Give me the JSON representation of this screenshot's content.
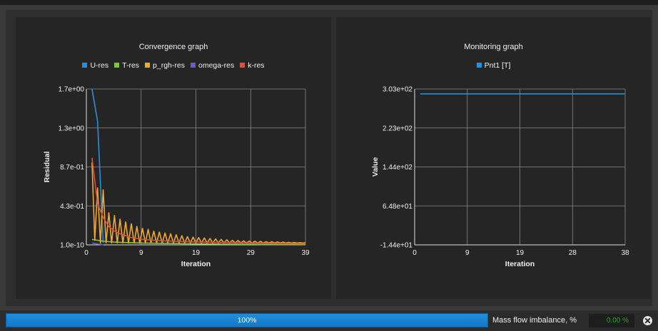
{
  "convergence": {
    "title": "Convergence graph",
    "legend": [
      {
        "name": "U-res",
        "color": "#2a8fd4"
      },
      {
        "name": "T-res",
        "color": "#7cc443"
      },
      {
        "name": "p_rgh-res",
        "color": "#f0a830"
      },
      {
        "name": "omega-res",
        "color": "#6a5acd"
      },
      {
        "name": "k-res",
        "color": "#d9533a"
      }
    ]
  },
  "monitoring": {
    "title": "Monitoring graph",
    "legend": [
      {
        "name": "Pnt1 [T]",
        "color": "#2a8fd4"
      }
    ]
  },
  "status": {
    "progress_value": 1.0,
    "progress_text": "100%",
    "mass_label": "Mass flow imbalance, %",
    "mass_value": "0.00 %",
    "close_icon": "close-icon",
    "colors": {
      "progress": "#1f8fdc",
      "mass_value": "#2ca02c"
    }
  },
  "chart_data": [
    {
      "type": "line",
      "title": "Convergence graph",
      "xlabel": "Iteration",
      "ylabel": "Residual",
      "xlim": [
        0,
        39
      ],
      "ylim": [
        1e-10,
        1.7
      ],
      "x_ticks": [
        "0",
        "9",
        "19",
        "29",
        "39"
      ],
      "y_ticks": [
        "1.0e-10",
        "4.3e-01",
        "8.7e-01",
        "1.3e+00",
        "1.7e+00"
      ],
      "grid": true,
      "legend_position": "top-center",
      "series": [
        {
          "name": "U-res",
          "color": "#2a8fd4",
          "x": [
            1,
            2,
            3
          ],
          "values": [
            1.7,
            1.35,
            0.02
          ]
        },
        {
          "name": "T-res",
          "color": "#7cc443",
          "x": [
            1,
            2,
            3,
            4,
            5,
            6,
            7,
            8,
            9,
            10,
            11,
            12,
            13,
            14,
            15,
            16,
            17,
            18,
            19,
            20,
            21,
            22,
            23,
            24,
            25,
            26,
            27,
            28,
            29,
            30,
            31,
            32,
            33,
            34,
            35,
            36,
            37,
            38,
            39
          ],
          "values": [
            0.06,
            0.05,
            0.04,
            0.035,
            0.03,
            0.028,
            0.026,
            0.024,
            0.022,
            0.02,
            0.019,
            0.018,
            0.017,
            0.016,
            0.015,
            0.014,
            0.013,
            0.012,
            0.011,
            0.01,
            0.01,
            0.009,
            0.009,
            0.008,
            0.008,
            0.007,
            0.007,
            0.006,
            0.006,
            0.006,
            0.005,
            0.005,
            0.005,
            0.005,
            0.004,
            0.004,
            0.004,
            0.004,
            0.004
          ]
        },
        {
          "name": "p_rgh-res",
          "color": "#f0a830",
          "x": [
            1,
            1.5,
            2,
            2.5,
            3,
            3.5,
            4,
            4.5,
            5,
            5.5,
            6,
            6.5,
            7,
            7.5,
            8,
            8.5,
            9,
            9.5,
            10,
            10.5,
            11,
            11.5,
            12,
            12.5,
            13,
            13.5,
            14,
            14.5,
            15,
            15.5,
            16,
            16.5,
            17,
            17.5,
            18,
            18.5,
            19,
            19.5,
            20,
            20.5,
            21,
            21.5,
            22,
            22.5,
            23,
            23.5,
            24,
            24.5,
            25,
            25.5,
            26,
            26.5,
            27,
            27.5,
            28,
            28.5,
            29,
            29.5,
            30,
            30.5,
            31,
            31.5,
            32,
            32.5,
            33,
            33.5,
            34,
            34.5,
            35,
            35.5,
            36,
            36.5,
            37,
            37.5,
            38,
            38.5,
            39
          ],
          "values": [
            0.9,
            0.05,
            0.62,
            0.02,
            0.6,
            0.02,
            0.35,
            0.02,
            0.32,
            0.02,
            0.28,
            0.02,
            0.25,
            0.02,
            0.23,
            0.02,
            0.2,
            0.02,
            0.18,
            0.02,
            0.17,
            0.02,
            0.15,
            0.02,
            0.14,
            0.02,
            0.13,
            0.02,
            0.12,
            0.02,
            0.11,
            0.02,
            0.1,
            0.02,
            0.09,
            0.02,
            0.085,
            0.02,
            0.08,
            0.02,
            0.075,
            0.02,
            0.07,
            0.02,
            0.065,
            0.02,
            0.06,
            0.02,
            0.055,
            0.02,
            0.05,
            0.02,
            0.048,
            0.02,
            0.045,
            0.02,
            0.042,
            0.02,
            0.04,
            0.02,
            0.038,
            0.02,
            0.036,
            0.02,
            0.034,
            0.02,
            0.032,
            0.02,
            0.03,
            0.02,
            0.028,
            0.02,
            0.026,
            0.02,
            0.025,
            0.02,
            0.024
          ]
        },
        {
          "name": "omega-res",
          "color": "#6a5acd",
          "x": [
            1,
            2,
            3
          ],
          "values": [
            0.02,
            0.01,
            0.0
          ]
        },
        {
          "name": "k-res",
          "color": "#d9533a",
          "x": [
            1,
            2,
            3,
            4,
            5,
            6,
            7,
            8,
            9,
            10,
            12,
            15,
            20,
            25,
            30,
            35,
            39
          ],
          "values": [
            0.95,
            0.45,
            0.3,
            0.2,
            0.15,
            0.12,
            0.1,
            0.08,
            0.07,
            0.06,
            0.05,
            0.04,
            0.03,
            0.025,
            0.02,
            0.015,
            0.012
          ]
        }
      ]
    },
    {
      "type": "line",
      "title": "Monitoring graph",
      "xlabel": "Iteration",
      "ylabel": "Value",
      "xlim": [
        0,
        38
      ],
      "ylim": [
        -14.4,
        303
      ],
      "x_ticks": [
        "0",
        "9",
        "19",
        "28",
        "38"
      ],
      "y_ticks": [
        "-1.44e+01",
        "6.48e+01",
        "1.44e+02",
        "2.23e+02",
        "3.03e+02"
      ],
      "grid": true,
      "legend_position": "top-center",
      "series": [
        {
          "name": "Pnt1 [T]",
          "color": "#2a8fd4",
          "x": [
            1,
            38
          ],
          "values": [
            293,
            293
          ]
        }
      ]
    }
  ]
}
